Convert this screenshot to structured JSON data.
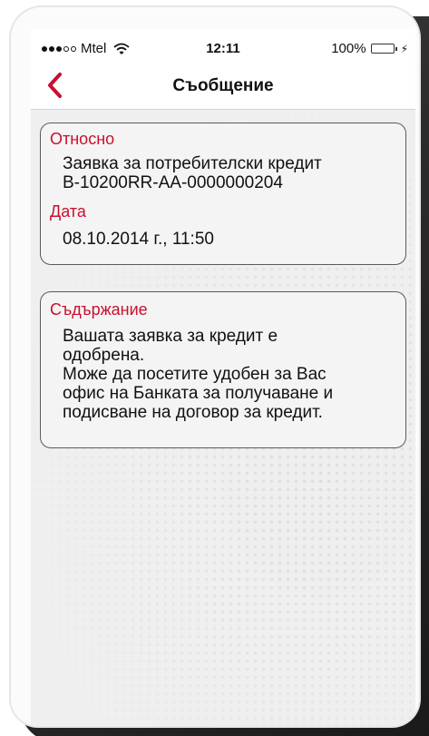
{
  "status_bar": {
    "carrier": "Mtel",
    "time": "12:11",
    "battery": "100%",
    "battery_level": 1.0
  },
  "nav": {
    "title": "Съобщение"
  },
  "message": {
    "subject_label": "Относно",
    "subject_value": "Заявка за потребителски кредит\nB-10200RR-AA-0000000204",
    "date_label": "Дата",
    "date_value": "08.10.2014 г., 11:50",
    "content_label": "Съдържание",
    "content_value": "Вашата заявка за кредит е\nодобрена.\n Може да  посетите удобен за Вас\nофис на Банката за получаване и\nподисване на договор за кредит."
  },
  "icons": {
    "back": "chevron-left-icon",
    "wifi": "wifi-icon",
    "charging": "bolt-icon"
  },
  "colors": {
    "accent": "#c8102e",
    "battery": "#2ecc40"
  }
}
